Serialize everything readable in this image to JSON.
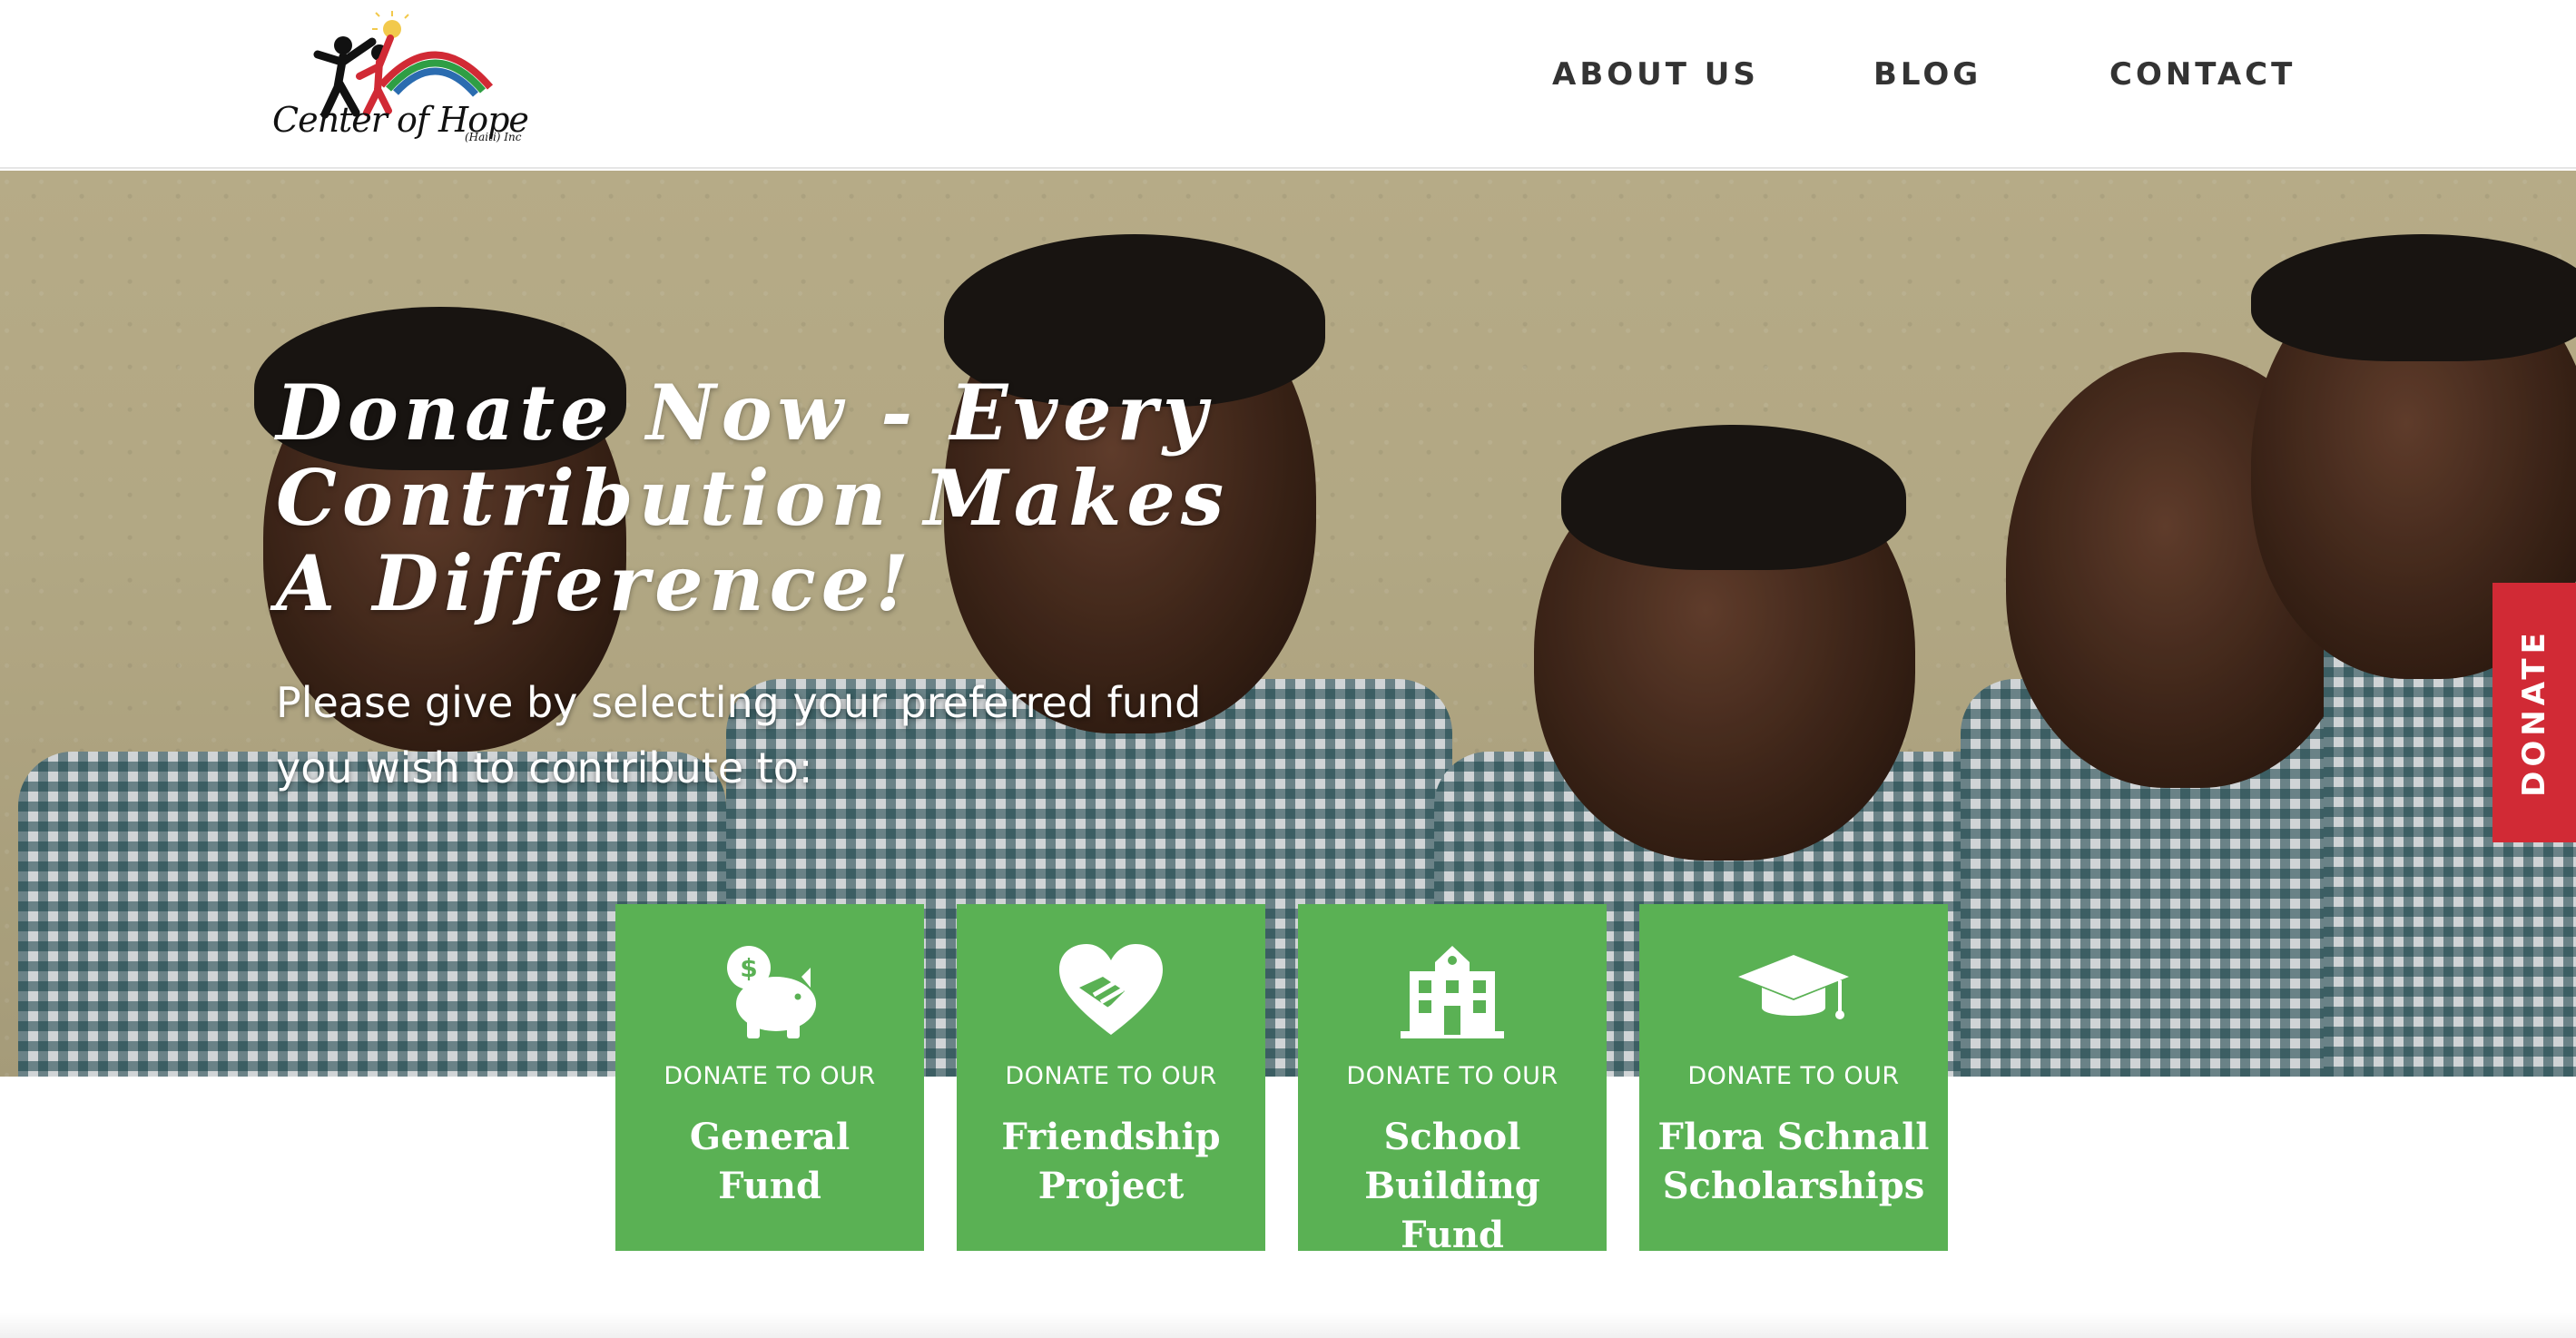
{
  "header": {
    "logo_text": "Center of Hope",
    "logo_sub": "(Haiti) Inc",
    "nav": [
      "ABOUT US",
      "BLOG",
      "CONTACT"
    ]
  },
  "hero": {
    "title": "Donate Now - Every Contribution Makes A Difference!",
    "subtitle": "Please give by selecting your preferred fund you wish to contribute to:"
  },
  "side_tab": {
    "label": "DONATE"
  },
  "funds": [
    {
      "pre": "DONATE TO OUR",
      "name": "General Fund",
      "icon": "piggy-bank-icon"
    },
    {
      "pre": "DONATE TO OUR",
      "name": "Friendship Project",
      "icon": "heart-handshake-icon"
    },
    {
      "pre": "DONATE TO OUR",
      "name": "School Building Fund",
      "icon": "school-building-icon"
    },
    {
      "pre": "DONATE TO OUR",
      "name": "Flora Schnall Scholarships",
      "icon": "graduation-cap-icon"
    }
  ],
  "colors": {
    "card_green": "#5ab154",
    "donate_red": "#d12a35",
    "nav_text": "#333333"
  }
}
